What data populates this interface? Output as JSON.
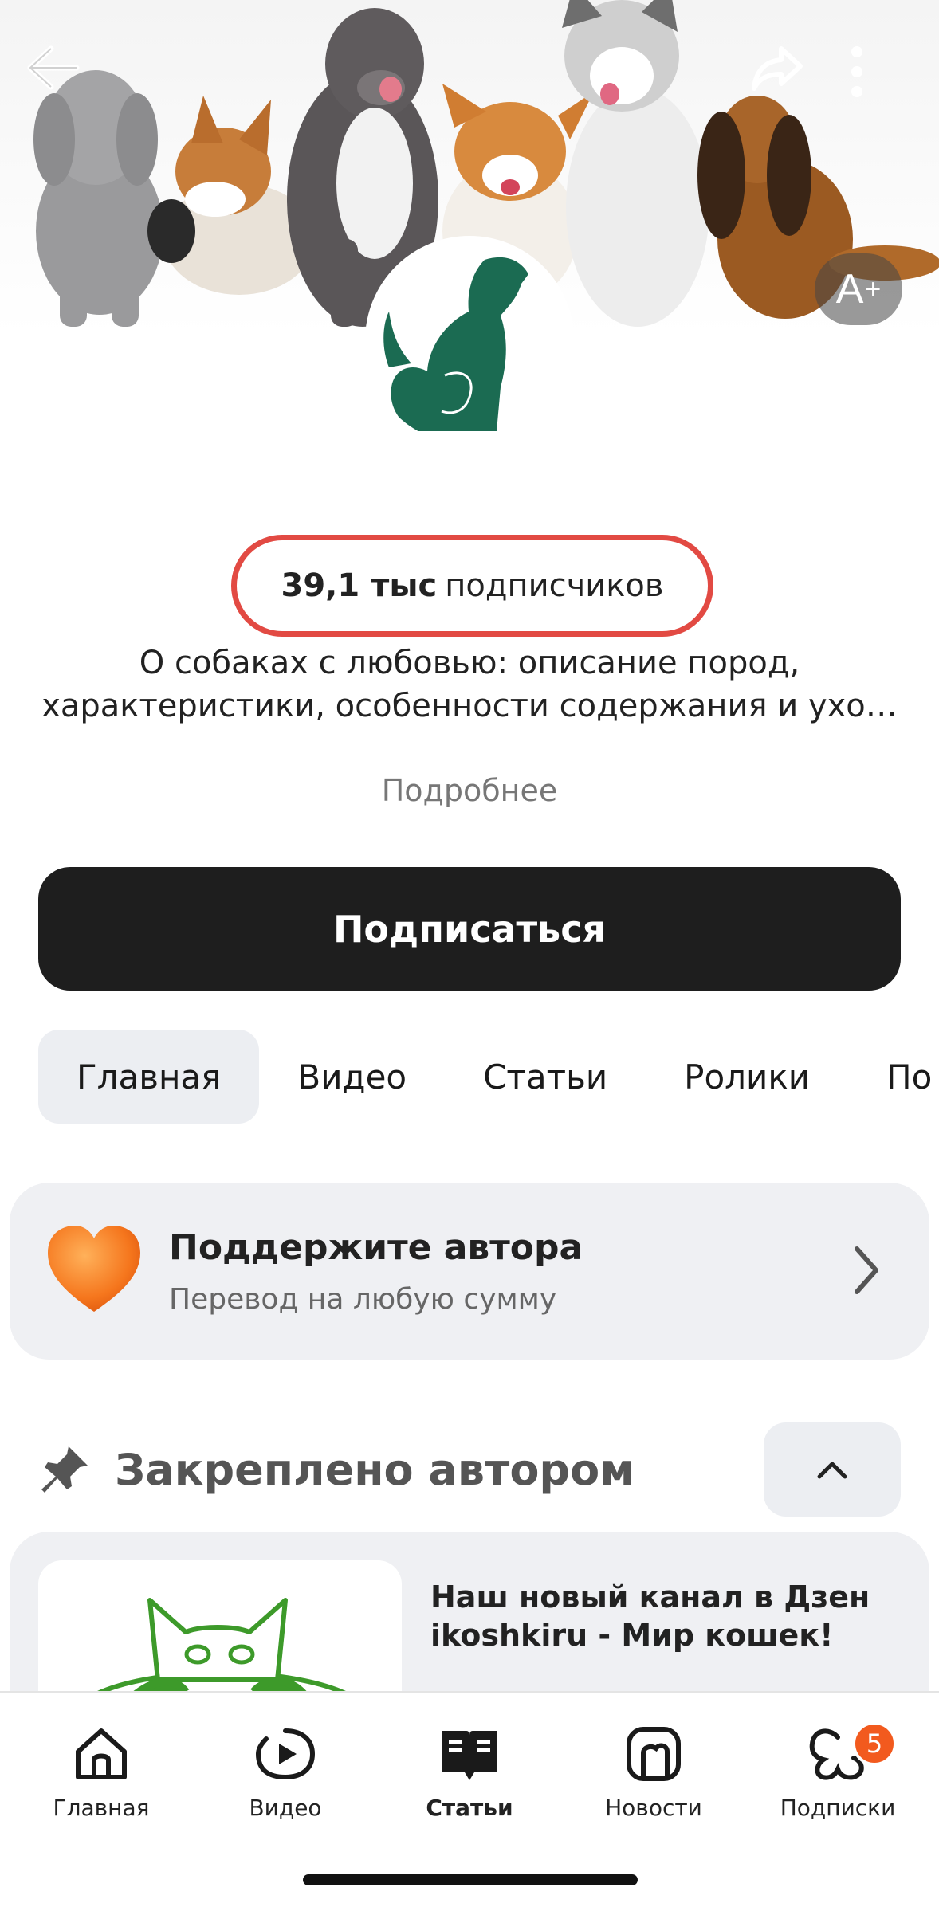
{
  "header": {
    "back_icon": "arrow-left-icon",
    "share_icon": "share-arrow-icon",
    "menu_icon": "vertical-dots-icon",
    "font_size_button": {
      "text": "A",
      "sup": "+"
    }
  },
  "channel": {
    "subscribers_count": "39,1 тыс",
    "subscribers_label": "подписчиков",
    "description": "О собаках с любовью: описание пород, характеристики, особенности содержания и ухо…",
    "more_link": "Подробнее",
    "subscribe_button": "Подписаться",
    "highlight_color": "#e24a43"
  },
  "tabs": [
    {
      "label": "Главная",
      "active": true
    },
    {
      "label": "Видео",
      "active": false
    },
    {
      "label": "Статьи",
      "active": false
    },
    {
      "label": "Ролики",
      "active": false
    },
    {
      "label": "По",
      "active": false
    }
  ],
  "support": {
    "title": "Поддержите автора",
    "subtitle": "Перевод на любую сумму",
    "icon": "heart-icon"
  },
  "pinned": {
    "label": "Закреплено автором",
    "icon": "pin-icon",
    "card": {
      "title": "Наш новый канал в Дзен ikoshkiru - Мир кошек!"
    }
  },
  "bottom_nav": [
    {
      "label": "Главная",
      "icon": "home-icon",
      "active": false
    },
    {
      "label": "Видео",
      "icon": "video-play-icon",
      "active": false
    },
    {
      "label": "Статьи",
      "icon": "articles-icon",
      "active": true
    },
    {
      "label": "Новости",
      "icon": "news-icon",
      "active": false
    },
    {
      "label": "Подписки",
      "icon": "subscriptions-icon",
      "active": false,
      "badge": "5"
    }
  ]
}
